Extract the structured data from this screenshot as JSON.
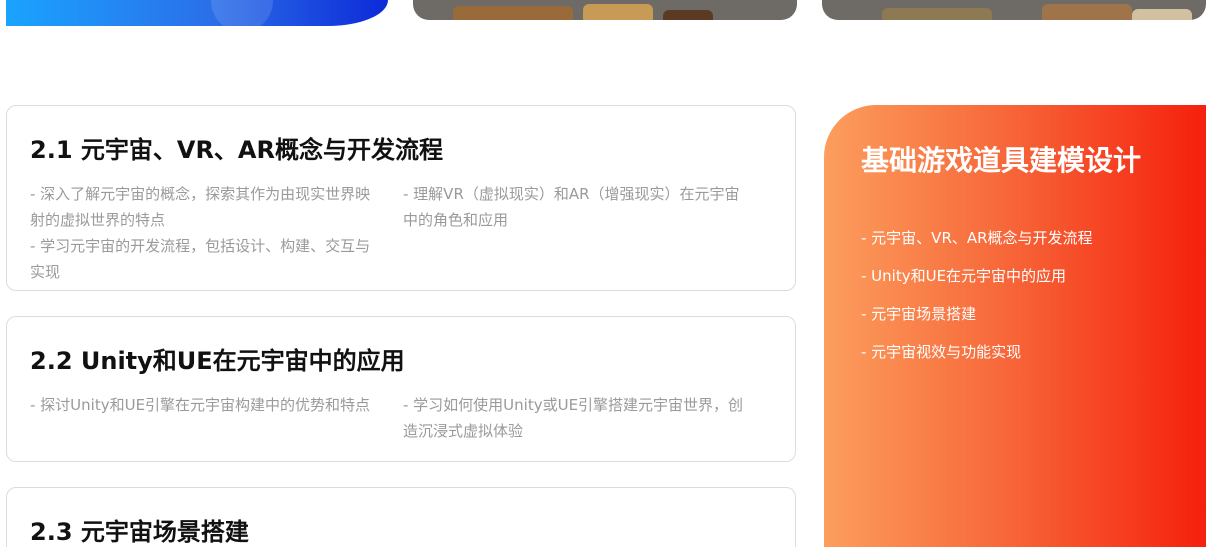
{
  "cards": [
    {
      "title": "2.1 元宇宙、VR、AR概念与开发流程",
      "left": [
        "- 深入了解元宇宙的概念，探索其作为由现实世界映射的虚拟世界的特点",
        "- 学习元宇宙的开发流程，包括设计、构建、交互与实现"
      ],
      "right": [
        "- 理解VR（虚拟现实）和AR（增强现实）在元宇宙中的角色和应用"
      ]
    },
    {
      "title": "2.2 Unity和UE在元宇宙中的应用",
      "left": [
        "- 探讨Unity和UE引擎在元宇宙构建中的优势和特点"
      ],
      "right": [
        "- 学习如何使用Unity或UE引擎搭建元宇宙世界，创造沉浸式虚拟体验"
      ]
    },
    {
      "title": "2.3 元宇宙场景搭建"
    }
  ],
  "panel": {
    "title": "基础游戏道具建模设计",
    "items": [
      "- 元宇宙、VR、AR概念与开发流程",
      "- Unity和UE在元宇宙中的应用",
      "- 元宇宙场景搭建",
      "- 元宇宙视效与功能实现"
    ]
  }
}
